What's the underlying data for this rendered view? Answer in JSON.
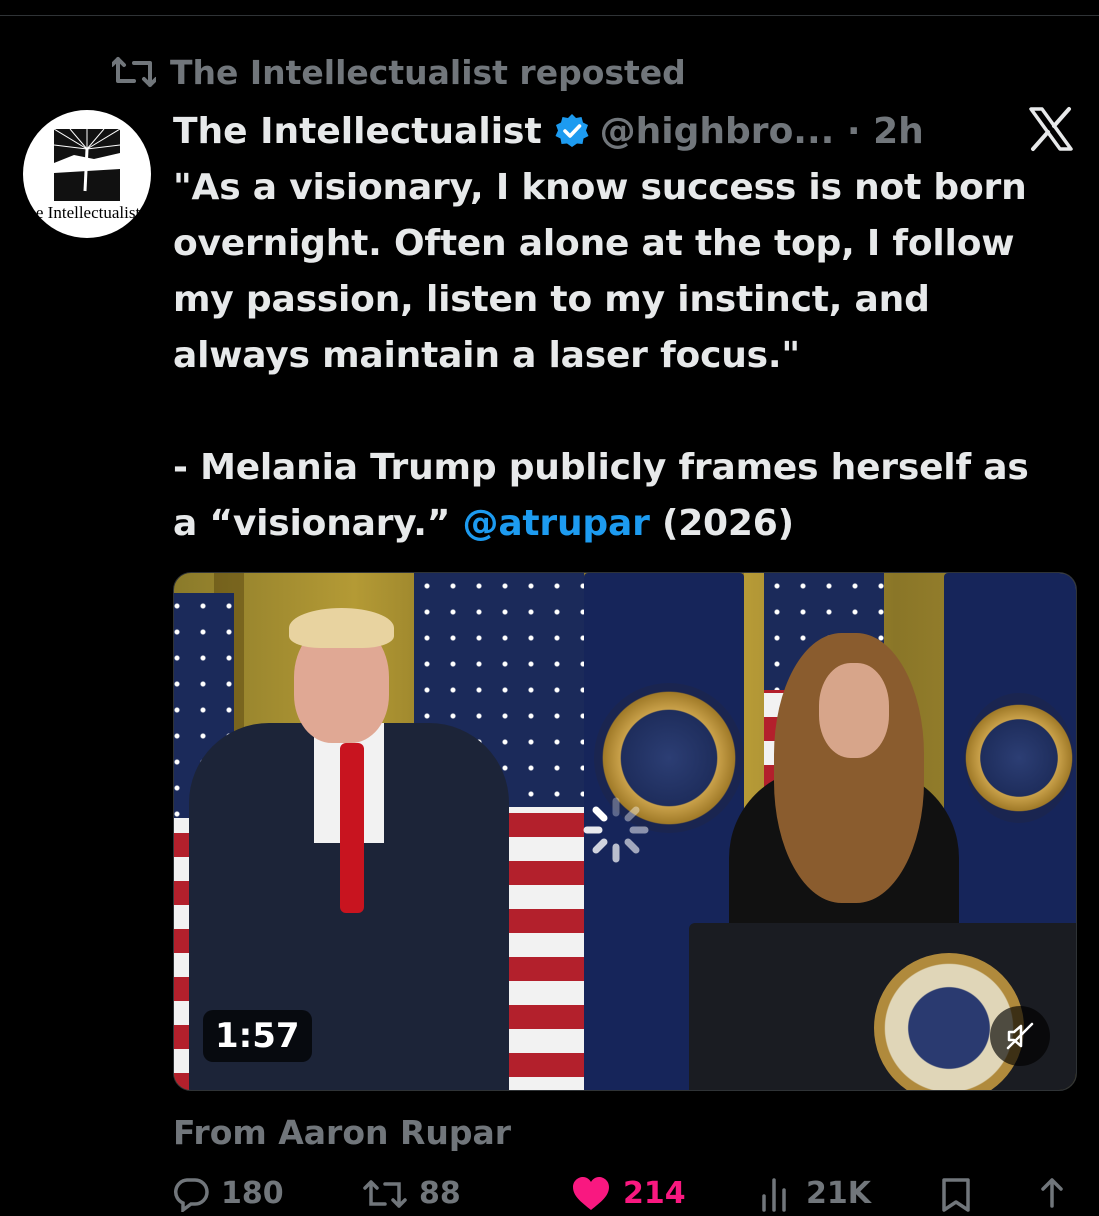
{
  "repost_banner": {
    "icon": "repost-icon",
    "text": "The Intellectualist reposted"
  },
  "post": {
    "author": {
      "name": "The Intellectualist",
      "verified_icon": "verified-badge-icon",
      "handle": "@highbro...",
      "time": "2h",
      "avatar_text": "The Intellectualist"
    },
    "menu_icon": "x-logo-icon",
    "text_lines": [
      "\"As a visionary, I know success is not born",
      "overnight. Often alone at the top, I follow",
      "my passion, listen to my instinct, and",
      "always maintain a laser focus.\""
    ],
    "quote_attribution_line1": "- Melania Trump publicly frames herself as",
    "quote_attribution_line2_prefix": "a “visionary.” ",
    "mention": "@atrupar",
    "quote_attribution_line2_suffix": " (2026)",
    "media": {
      "type": "video",
      "duration": "1:57",
      "mute_icon": "muted-speaker-icon",
      "loading_icon": "loading-spinner-icon"
    },
    "source": "From Aaron Rupar",
    "actions": {
      "replies": "180",
      "reposts": "88",
      "likes": "214",
      "views": "21K"
    }
  },
  "colors": {
    "background": "#000000",
    "text_primary": "#e7e9ea",
    "text_secondary": "#71767b",
    "link": "#1d9bf0",
    "verified": "#1d9bf0",
    "like": "#f91880",
    "divider": "#2f3336"
  }
}
